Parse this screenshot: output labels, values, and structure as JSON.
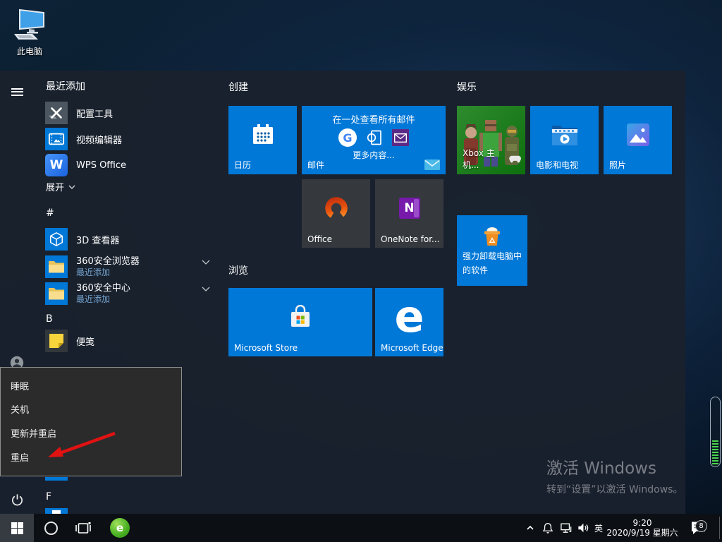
{
  "desktop": {
    "this_pc_label": "此电脑",
    "watermark_title": "激活 Windows",
    "watermark_subtitle": "转到“设置”以激活 Windows。"
  },
  "start_menu": {
    "recent_header": "最近添加",
    "recent_apps": [
      {
        "label": "配置工具"
      },
      {
        "label": "视频编辑器"
      },
      {
        "label": "WPS Office"
      }
    ],
    "expand_label": "展开",
    "sections": {
      "hash": "#",
      "b": "B",
      "f": "F"
    },
    "apps": [
      {
        "label": "3D 查看器"
      },
      {
        "label": "360安全浏览器",
        "sublabel": "最近添加"
      },
      {
        "label": "360安全中心",
        "sublabel": "最近添加"
      },
      {
        "label": "便笺"
      }
    ],
    "groups": {
      "create": "创建",
      "browse": "浏览",
      "entertainment": "娱乐"
    },
    "tiles": {
      "calendar": "日历",
      "mail": "邮件",
      "mail_banner": "在一处查看所有邮件",
      "mail_more": "更多内容...",
      "office": "Office",
      "onenote": "OneNote for...",
      "store": "Microsoft Store",
      "edge": "Microsoft Edge",
      "xbox": "Xbox 主机...",
      "movies": "电影和电视",
      "photos": "照片",
      "uninstaller": "强力卸载电脑中的软件"
    }
  },
  "power_menu": {
    "items": [
      {
        "label": "睡眠"
      },
      {
        "label": "关机"
      },
      {
        "label": "更新并重启"
      },
      {
        "label": "重启"
      }
    ]
  },
  "taskbar": {
    "ime": "英",
    "time": "9:20",
    "date": "2020/9/19 星期六",
    "notification_count": "8"
  },
  "icon_glyphs": {
    "edge": "e",
    "wps": "W",
    "onenote": "N",
    "google": "G",
    "browser360": "e"
  },
  "colors": {
    "accent": "#0078d7",
    "xbox_green": "#107c10",
    "arrow_red": "#e01212",
    "menu_bg": "#1a212d",
    "flyout_bg": "#2b2b2b"
  }
}
